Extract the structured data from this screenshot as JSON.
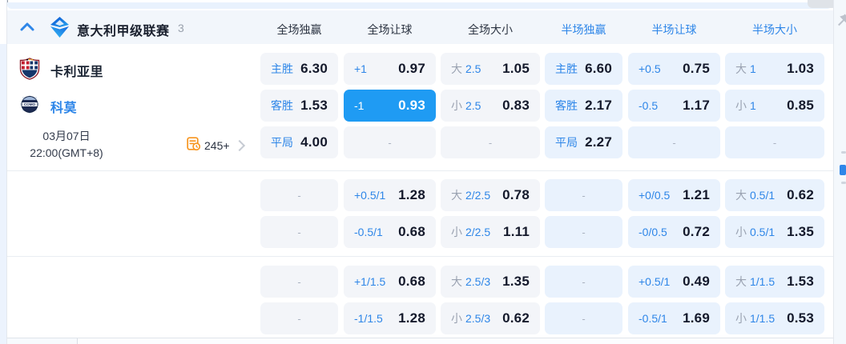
{
  "header": {
    "league": "意大利甲级联赛",
    "count": "3",
    "columns": [
      {
        "label": "全场独赢"
      },
      {
        "label": "全场让球"
      },
      {
        "label": "全场大小"
      },
      {
        "label": "半场独赢"
      },
      {
        "label": "半场让球"
      },
      {
        "label": "半场大小"
      }
    ]
  },
  "match": {
    "home": "卡利亚里",
    "away": "科莫",
    "date": "03月07日",
    "time": "22:00(GMT+8)",
    "more_count": "245+"
  },
  "ui": {
    "dash": "-"
  },
  "colors": {
    "accent_blue": "#2e86e8",
    "selected_cell": "#1f9bf3",
    "full_cell_bg": "#f3f5f9",
    "half_cell_bg": "#e9f2fd",
    "value_text": "#14192b"
  },
  "odds_rows": [
    [
      {
        "label": "主胜",
        "value": "6.30"
      },
      {
        "label": "+1",
        "value": "0.97"
      },
      {
        "side": "大",
        "line": "2.5",
        "value": "1.05"
      },
      {
        "label": "主胜",
        "value": "6.60"
      },
      {
        "label": "+0.5",
        "value": "0.75"
      },
      {
        "side": "大",
        "line": "1",
        "value": "1.03"
      }
    ],
    [
      {
        "label": "客胜",
        "value": "1.53"
      },
      {
        "label": "-1",
        "value": "0.93",
        "selected": true
      },
      {
        "side": "小",
        "line": "2.5",
        "value": "0.83"
      },
      {
        "label": "客胜",
        "value": "2.17"
      },
      {
        "label": "-0.5",
        "value": "1.17"
      },
      {
        "side": "小",
        "line": "1",
        "value": "0.85"
      }
    ],
    [
      {
        "label": "平局",
        "value": "4.00"
      },
      {
        "empty": true
      },
      {
        "empty": true
      },
      {
        "label": "平局",
        "value": "2.27"
      },
      {
        "empty": true
      },
      {
        "empty": true
      }
    ],
    [
      {
        "empty": true
      },
      {
        "label": "+0.5/1",
        "value": "1.28"
      },
      {
        "side": "大",
        "line": "2/2.5",
        "value": "0.78"
      },
      {
        "empty": true
      },
      {
        "label": "+0/0.5",
        "value": "1.21"
      },
      {
        "side": "大",
        "line": "0.5/1",
        "value": "0.62"
      }
    ],
    [
      {
        "empty": true
      },
      {
        "label": "-0.5/1",
        "value": "0.68"
      },
      {
        "side": "小",
        "line": "2/2.5",
        "value": "1.11"
      },
      {
        "empty": true
      },
      {
        "label": "-0/0.5",
        "value": "0.72"
      },
      {
        "side": "小",
        "line": "0.5/1",
        "value": "1.35"
      }
    ],
    [
      {
        "empty": true
      },
      {
        "label": "+1/1.5",
        "value": "0.68"
      },
      {
        "side": "大",
        "line": "2.5/3",
        "value": "1.35"
      },
      {
        "empty": true
      },
      {
        "label": "+0.5/1",
        "value": "0.49"
      },
      {
        "side": "大",
        "line": "1/1.5",
        "value": "1.53"
      }
    ],
    [
      {
        "empty": true
      },
      {
        "label": "-1/1.5",
        "value": "1.28"
      },
      {
        "side": "小",
        "line": "2.5/3",
        "value": "0.62"
      },
      {
        "empty": true
      },
      {
        "label": "-0.5/1",
        "value": "1.69"
      },
      {
        "side": "小",
        "line": "1/1.5",
        "value": "0.53"
      }
    ]
  ]
}
